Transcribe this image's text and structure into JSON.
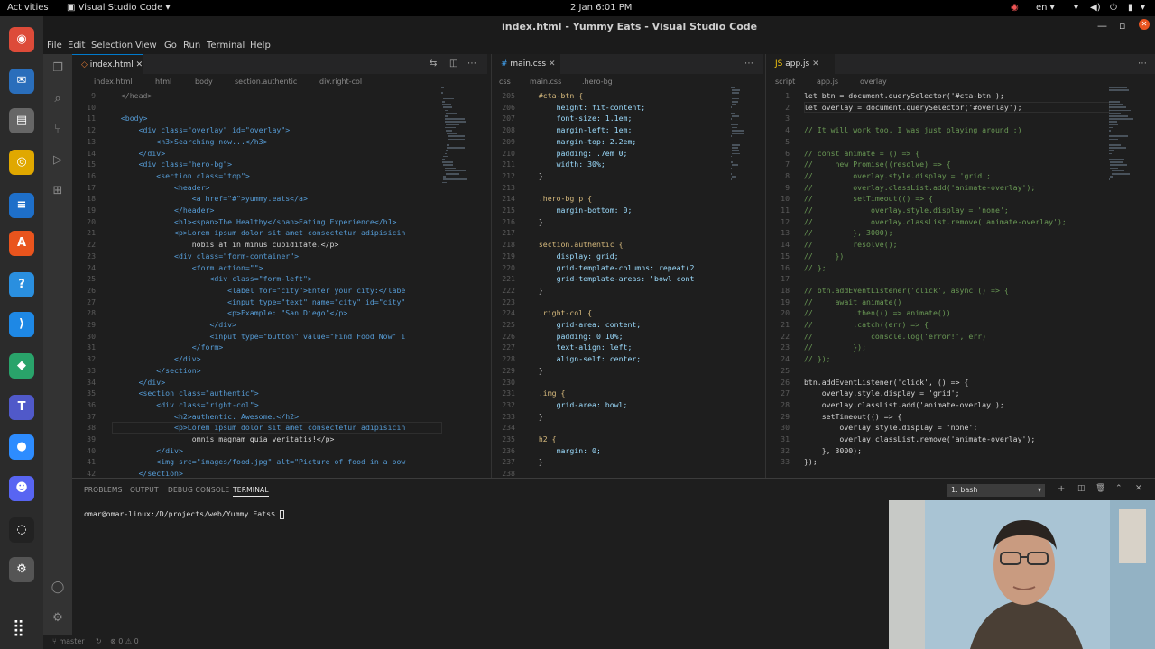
{
  "topbar": {
    "activities": "Activities",
    "app": "Visual Studio Code",
    "clock": "2 Jan  6:01 PM",
    "lang": "en"
  },
  "window": {
    "title": "index.html - Yummy Eats - Visual Studio Code"
  },
  "menu": [
    "File",
    "Edit",
    "Selection",
    "View",
    "Go",
    "Run",
    "Terminal",
    "Help"
  ],
  "dock": [
    {
      "name": "chrome-icon",
      "glyph": "◉",
      "color": "#dd4b39"
    },
    {
      "name": "thunderbird-icon",
      "glyph": "✉",
      "color": "#2a6ebb"
    },
    {
      "name": "files-icon",
      "glyph": "▤",
      "color": "#666666"
    },
    {
      "name": "rhythmbox-icon",
      "glyph": "◎",
      "color": "#e0a800"
    },
    {
      "name": "writer-icon",
      "glyph": "≡",
      "color": "#1e6fc9"
    },
    {
      "name": "software-icon",
      "glyph": "A",
      "color": "#e9541d"
    },
    {
      "name": "help-icon",
      "glyph": "?",
      "color": "#2a8fdf"
    },
    {
      "name": "vscode-icon",
      "glyph": "⟩",
      "color": "#1e88e5"
    },
    {
      "name": "box-icon",
      "glyph": "◆",
      "color": "#29a36a"
    },
    {
      "name": "teams-icon",
      "glyph": "T",
      "color": "#5059c9"
    },
    {
      "name": "zoom-icon",
      "glyph": "●",
      "color": "#2d8cff"
    },
    {
      "name": "discord-icon",
      "glyph": "☻",
      "color": "#5865f2"
    },
    {
      "name": "obs-icon",
      "glyph": "◌",
      "color": "#222222"
    },
    {
      "name": "settings-icon",
      "glyph": "⚙",
      "color": "#555555"
    }
  ],
  "editor1": {
    "tab": "index.html",
    "breadcrumb": [
      "index.html",
      "html",
      "body",
      "section.authentic",
      "div.right-col"
    ],
    "lines": [
      {
        "n": "9",
        "t": "  </head>",
        "c": "#808080"
      },
      {
        "n": "10",
        "t": "",
        "c": "#ccc"
      },
      {
        "n": "11",
        "t": "  <body>",
        "c": "#569cd6"
      },
      {
        "n": "12",
        "t": "      <div class=\"overlay\" id=\"overlay\">",
        "c": "#569cd6"
      },
      {
        "n": "13",
        "t": "          <h3>Searching now...</h3>",
        "c": "#569cd6"
      },
      {
        "n": "14",
        "t": "      </div>",
        "c": "#569cd6"
      },
      {
        "n": "15",
        "t": "      <div class=\"hero-bg\">",
        "c": "#569cd6"
      },
      {
        "n": "16",
        "t": "          <section class=\"top\">",
        "c": "#569cd6"
      },
      {
        "n": "17",
        "t": "              <header>",
        "c": "#569cd6"
      },
      {
        "n": "18",
        "t": "                  <a href=\"#\">yummy.eats</a>",
        "c": "#569cd6"
      },
      {
        "n": "19",
        "t": "              </header>",
        "c": "#569cd6"
      },
      {
        "n": "20",
        "t": "              <h1><span>The Healthy</span>Eating Experience</h1>",
        "c": "#569cd6"
      },
      {
        "n": "21",
        "t": "              <p>Lorem ipsum dolor sit amet consectetur adipisicin",
        "c": "#569cd6"
      },
      {
        "n": "22",
        "t": "                  nobis at in minus cupiditate.</p>",
        "c": "#d4d4d4"
      },
      {
        "n": "23",
        "t": "              <div class=\"form-container\">",
        "c": "#569cd6"
      },
      {
        "n": "24",
        "t": "                  <form action=\"\">",
        "c": "#569cd6"
      },
      {
        "n": "25",
        "t": "                      <div class=\"form-left\">",
        "c": "#569cd6"
      },
      {
        "n": "26",
        "t": "                          <label for=\"city\">Enter your city:</labe",
        "c": "#569cd6"
      },
      {
        "n": "27",
        "t": "                          <input type=\"text\" name=\"city\" id=\"city\"",
        "c": "#569cd6"
      },
      {
        "n": "28",
        "t": "                          <p>Example: \"San Diego\"</p>",
        "c": "#569cd6"
      },
      {
        "n": "29",
        "t": "                      </div>",
        "c": "#569cd6"
      },
      {
        "n": "30",
        "t": "                      <input type=\"button\" value=\"Find Food Now\" i",
        "c": "#569cd6"
      },
      {
        "n": "31",
        "t": "                  </form>",
        "c": "#569cd6"
      },
      {
        "n": "32",
        "t": "              </div>",
        "c": "#569cd6"
      },
      {
        "n": "33",
        "t": "          </section>",
        "c": "#569cd6"
      },
      {
        "n": "34",
        "t": "      </div>",
        "c": "#569cd6"
      },
      {
        "n": "35",
        "t": "      <section class=\"authentic\">",
        "c": "#569cd6"
      },
      {
        "n": "36",
        "t": "          <div class=\"right-col\">",
        "c": "#569cd6"
      },
      {
        "n": "37",
        "t": "              <h2>authentic. Awesome.</h2>",
        "c": "#569cd6"
      },
      {
        "n": "38",
        "t": "              <p>Lorem ipsum dolor sit amet consectetur adipisicin",
        "c": "#569cd6"
      },
      {
        "n": "39",
        "t": "                  omnis magnam quia veritatis!</p>",
        "c": "#d4d4d4"
      },
      {
        "n": "40",
        "t": "          </div>",
        "c": "#569cd6"
      },
      {
        "n": "41",
        "t": "          <img src=\"images/food.jpg\" alt=\"Picture of food in a bow",
        "c": "#569cd6"
      },
      {
        "n": "42",
        "t": "      </section>",
        "c": "#569cd6"
      }
    ]
  },
  "editor2": {
    "tab": "main.css",
    "breadcrumb": [
      "css",
      "main.css",
      ".hero-bg"
    ],
    "lines": [
      {
        "n": "205",
        "t": "  #cta-btn {",
        "c": "#d7ba7d"
      },
      {
        "n": "206",
        "t": "      height: fit-content;",
        "c": "#9cdcfe"
      },
      {
        "n": "207",
        "t": "      font-size: 1.1em;",
        "c": "#9cdcfe"
      },
      {
        "n": "208",
        "t": "      margin-left: 1em;",
        "c": "#9cdcfe"
      },
      {
        "n": "209",
        "t": "      margin-top: 2.2em;",
        "c": "#9cdcfe"
      },
      {
        "n": "210",
        "t": "      padding: .7em 0;",
        "c": "#9cdcfe"
      },
      {
        "n": "211",
        "t": "      width: 30%;",
        "c": "#9cdcfe"
      },
      {
        "n": "212",
        "t": "  }",
        "c": "#d4d4d4"
      },
      {
        "n": "213",
        "t": "",
        "c": "#ccc"
      },
      {
        "n": "214",
        "t": "  .hero-bg p {",
        "c": "#d7ba7d"
      },
      {
        "n": "215",
        "t": "      margin-bottom: 0;",
        "c": "#9cdcfe"
      },
      {
        "n": "216",
        "t": "  }",
        "c": "#d4d4d4"
      },
      {
        "n": "217",
        "t": "",
        "c": "#ccc"
      },
      {
        "n": "218",
        "t": "  section.authentic {",
        "c": "#d7ba7d"
      },
      {
        "n": "219",
        "t": "      display: grid;",
        "c": "#9cdcfe"
      },
      {
        "n": "220",
        "t": "      grid-template-columns: repeat(2",
        "c": "#9cdcfe"
      },
      {
        "n": "221",
        "t": "      grid-template-areas: 'bowl cont",
        "c": "#9cdcfe"
      },
      {
        "n": "222",
        "t": "  }",
        "c": "#d4d4d4"
      },
      {
        "n": "223",
        "t": "",
        "c": "#ccc"
      },
      {
        "n": "224",
        "t": "  .right-col {",
        "c": "#d7ba7d"
      },
      {
        "n": "225",
        "t": "      grid-area: content;",
        "c": "#9cdcfe"
      },
      {
        "n": "226",
        "t": "      padding: 0 10%;",
        "c": "#9cdcfe"
      },
      {
        "n": "227",
        "t": "      text-align: left;",
        "c": "#9cdcfe"
      },
      {
        "n": "228",
        "t": "      align-self: center;",
        "c": "#9cdcfe"
      },
      {
        "n": "229",
        "t": "  }",
        "c": "#d4d4d4"
      },
      {
        "n": "230",
        "t": "",
        "c": "#ccc"
      },
      {
        "n": "231",
        "t": "  .img {",
        "c": "#d7ba7d"
      },
      {
        "n": "232",
        "t": "      grid-area: bowl;",
        "c": "#9cdcfe"
      },
      {
        "n": "233",
        "t": "  }",
        "c": "#d4d4d4"
      },
      {
        "n": "234",
        "t": "",
        "c": "#ccc"
      },
      {
        "n": "235",
        "t": "  h2 {",
        "c": "#d7ba7d"
      },
      {
        "n": "236",
        "t": "      margin: 0;",
        "c": "#9cdcfe"
      },
      {
        "n": "237",
        "t": "  }",
        "c": "#d4d4d4"
      },
      {
        "n": "238",
        "t": "",
        "c": "#ccc"
      }
    ]
  },
  "editor3": {
    "tab": "app.js",
    "breadcrumb": [
      "script",
      "app.js",
      "overlay"
    ],
    "lines": [
      {
        "n": "1",
        "t": "let btn = document.querySelector('#cta-btn');",
        "c": "#d4d4d4"
      },
      {
        "n": "2",
        "t": "let overlay = document.querySelector('#overlay');",
        "c": "#d4d4d4"
      },
      {
        "n": "3",
        "t": "",
        "c": "#ccc"
      },
      {
        "n": "4",
        "t": "// It will work too, I was just playing around :)",
        "c": "#6a9955"
      },
      {
        "n": "5",
        "t": "",
        "c": "#ccc"
      },
      {
        "n": "6",
        "t": "// const animate = () => {",
        "c": "#6a9955"
      },
      {
        "n": "7",
        "t": "//     new Promise((resolve) => {",
        "c": "#6a9955"
      },
      {
        "n": "8",
        "t": "//         overlay.style.display = 'grid';",
        "c": "#6a9955"
      },
      {
        "n": "9",
        "t": "//         overlay.classList.add('animate-overlay');",
        "c": "#6a9955"
      },
      {
        "n": "10",
        "t": "//         setTimeout(() => {",
        "c": "#6a9955"
      },
      {
        "n": "11",
        "t": "//             overlay.style.display = 'none';",
        "c": "#6a9955"
      },
      {
        "n": "12",
        "t": "//             overlay.classList.remove('animate-overlay');",
        "c": "#6a9955"
      },
      {
        "n": "13",
        "t": "//         }, 3000);",
        "c": "#6a9955"
      },
      {
        "n": "14",
        "t": "//         resolve();",
        "c": "#6a9955"
      },
      {
        "n": "15",
        "t": "//     })",
        "c": "#6a9955"
      },
      {
        "n": "16",
        "t": "// };",
        "c": "#6a9955"
      },
      {
        "n": "17",
        "t": "",
        "c": "#ccc"
      },
      {
        "n": "18",
        "t": "// btn.addEventListener('click', async () => {",
        "c": "#6a9955"
      },
      {
        "n": "19",
        "t": "//     await animate()",
        "c": "#6a9955"
      },
      {
        "n": "20",
        "t": "//         .then(() => animate())",
        "c": "#6a9955"
      },
      {
        "n": "21",
        "t": "//         .catch((err) => {",
        "c": "#6a9955"
      },
      {
        "n": "22",
        "t": "//             console.log('error!', err)",
        "c": "#6a9955"
      },
      {
        "n": "23",
        "t": "//         });",
        "c": "#6a9955"
      },
      {
        "n": "24",
        "t": "// });",
        "c": "#6a9955"
      },
      {
        "n": "25",
        "t": "",
        "c": "#ccc"
      },
      {
        "n": "26",
        "t": "btn.addEventListener('click', () => {",
        "c": "#d4d4d4"
      },
      {
        "n": "27",
        "t": "    overlay.style.display = 'grid';",
        "c": "#d4d4d4"
      },
      {
        "n": "28",
        "t": "    overlay.classList.add('animate-overlay');",
        "c": "#d4d4d4"
      },
      {
        "n": "29",
        "t": "    setTimeout(() => {",
        "c": "#d4d4d4"
      },
      {
        "n": "30",
        "t": "        overlay.style.display = 'none';",
        "c": "#d4d4d4"
      },
      {
        "n": "31",
        "t": "        overlay.classList.remove('animate-overlay');",
        "c": "#d4d4d4"
      },
      {
        "n": "32",
        "t": "    }, 3000);",
        "c": "#d4d4d4"
      },
      {
        "n": "33",
        "t": "});",
        "c": "#d4d4d4"
      }
    ]
  },
  "panel": {
    "tabs": [
      "PROBLEMS",
      "OUTPUT",
      "DEBUG CONSOLE",
      "TERMINAL"
    ],
    "terminal_select": "1: bash",
    "prompt": "omar@omar-linux:/D/projects/web/Yummy Eats$"
  },
  "status": {
    "branch": "master",
    "problems": "⊗ 0 ⚠ 0"
  }
}
